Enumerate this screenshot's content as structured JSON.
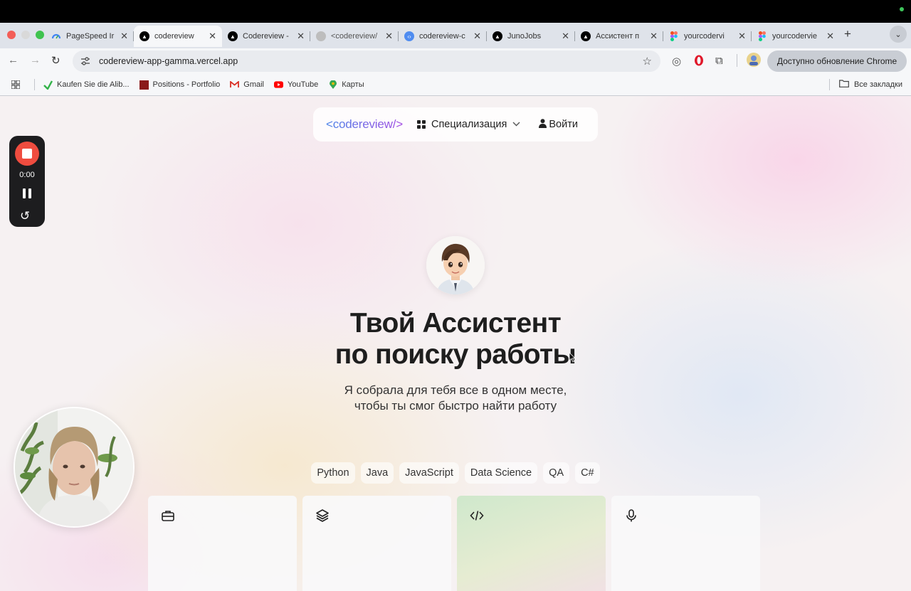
{
  "browser": {
    "tabs": [
      {
        "title": "PageSpeed Ir",
        "favicon": "pagespeed-icon",
        "color": "#4285f4"
      },
      {
        "title": "codereview",
        "favicon": "vercel-icon",
        "color": "#000000",
        "active": true
      },
      {
        "title": "Codereview -",
        "favicon": "vercel-icon",
        "color": "#000000"
      },
      {
        "title": "<codereview/",
        "favicon": "globe-icon",
        "color": "#bdbdbd"
      },
      {
        "title": "codereview-c",
        "favicon": "code-icon",
        "color": "#4f8cf0"
      },
      {
        "title": "JunoJobs",
        "favicon": "vercel-icon",
        "color": "#000000"
      },
      {
        "title": "Ассистент п",
        "favicon": "vercel-icon",
        "color": "#000000"
      },
      {
        "title": "yourcodervi",
        "favicon": "figma-icon",
        "color": "#f24e1e"
      },
      {
        "title": "yourcodervie",
        "favicon": "figma-icon",
        "color": "#a259ff"
      }
    ],
    "url": "codereview-app-gamma.vercel.app",
    "update_label": "Доступно обновление Chrome",
    "bookmarks": [
      {
        "label": "Kaufen Sie die Alib...",
        "icon": "alibaba-icon"
      },
      {
        "label": "Positions - Portfolio",
        "icon": "portfolio-icon"
      },
      {
        "label": "Gmail",
        "icon": "gmail-icon"
      },
      {
        "label": "YouTube",
        "icon": "youtube-icon"
      },
      {
        "label": "Карты",
        "icon": "maps-icon"
      }
    ],
    "all_bookmarks_label": "Все закладки"
  },
  "site": {
    "logo": "<codereview/>",
    "nav_specialization": "Специализация",
    "nav_login": "Войти",
    "hero_title_line1": "Твой Ассистент",
    "hero_title_line2": "по поиску работы",
    "hero_sub_line1": "Я собрала для тебя все в одном месте,",
    "hero_sub_line2": "чтобы ты смог быстро найти работу",
    "chips": [
      "Python",
      "Java",
      "JavaScript",
      "Data Science",
      "QA",
      "C#"
    ],
    "cards": [
      {
        "icon": "briefcase-icon"
      },
      {
        "icon": "layers-icon"
      },
      {
        "icon": "code-icon"
      },
      {
        "icon": "microphone-icon"
      }
    ]
  },
  "recorder": {
    "time": "0:00"
  },
  "colors": {
    "accent_start": "#4a83e8",
    "accent_end": "#a24be3",
    "record_red": "#ef4c3f"
  }
}
